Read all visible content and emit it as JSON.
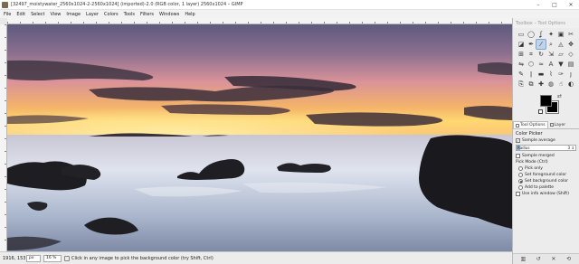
{
  "window": {
    "title": "[32497_moistywater_2560x1024-2-2560x1024] (imported)-2.0 (RGB color, 1 layer) 2560x1024 – GIMP",
    "minimize": "–",
    "maximize": "□",
    "close": "✕"
  },
  "menu": [
    "File",
    "Edit",
    "Select",
    "View",
    "Image",
    "Layer",
    "Colors",
    "Tools",
    "Filters",
    "Windows",
    "Help"
  ],
  "dock": {
    "header": "Toolbox – Tool Options",
    "tools": [
      {
        "icon": "rect-select-icon",
        "glyph": "▭"
      },
      {
        "icon": "ellipse-select-icon",
        "glyph": "◯"
      },
      {
        "icon": "free-select-icon",
        "glyph": "ʆ"
      },
      {
        "icon": "fuzzy-select-icon",
        "glyph": "✦"
      },
      {
        "icon": "color-select-icon",
        "glyph": "▣"
      },
      {
        "icon": "scissors-icon",
        "glyph": "✂"
      },
      {
        "icon": "foreground-select-icon",
        "glyph": "◪"
      },
      {
        "icon": "paths-icon",
        "glyph": "✒"
      },
      {
        "icon": "color-picker-icon",
        "glyph": "⁄"
      },
      {
        "icon": "zoom-icon",
        "glyph": "⌕"
      },
      {
        "icon": "measure-icon",
        "glyph": "◬"
      },
      {
        "icon": "move-icon",
        "glyph": "✥"
      },
      {
        "icon": "align-icon",
        "glyph": "⊞"
      },
      {
        "icon": "crop-icon",
        "glyph": "⌗"
      },
      {
        "icon": "rotate-icon",
        "glyph": "↻"
      },
      {
        "icon": "scale-icon",
        "glyph": "⇲"
      },
      {
        "icon": "shear-icon",
        "glyph": "▱"
      },
      {
        "icon": "perspective-icon",
        "glyph": "◇"
      },
      {
        "icon": "flip-icon",
        "glyph": "⇋"
      },
      {
        "icon": "cage-icon",
        "glyph": "⬡"
      },
      {
        "icon": "warp-icon",
        "glyph": "≈"
      },
      {
        "icon": "text-icon",
        "glyph": "A"
      },
      {
        "icon": "bucket-fill-icon",
        "glyph": "▼"
      },
      {
        "icon": "gradient-icon",
        "glyph": "▤"
      },
      {
        "icon": "pencil-icon",
        "glyph": "✎"
      },
      {
        "icon": "paintbrush-icon",
        "glyph": "ǀ"
      },
      {
        "icon": "eraser-icon",
        "glyph": "▬"
      },
      {
        "icon": "airbrush-icon",
        "glyph": "⌇"
      },
      {
        "icon": "ink-icon",
        "glyph": "✑"
      },
      {
        "icon": "mypaint-brush-icon",
        "glyph": "ȷ"
      },
      {
        "icon": "clone-icon",
        "glyph": "⎘"
      },
      {
        "icon": "perspective-clone-icon",
        "glyph": "⧉"
      },
      {
        "icon": "heal-icon",
        "glyph": "✚"
      },
      {
        "icon": "blur-icon",
        "glyph": "◍"
      },
      {
        "icon": "smudge-icon",
        "glyph": "☝"
      },
      {
        "icon": "dodge-burn-icon",
        "glyph": "◐"
      }
    ],
    "active_tool_index": 8,
    "tabs": [
      {
        "icon": "tool-options-icon",
        "label": "Tool Options"
      },
      {
        "icon": "layers-icon",
        "label": "Layer"
      }
    ],
    "options": {
      "title": "Color Picker",
      "sample_average": "Sample average",
      "radius_label": "Radius",
      "radius_value": "3",
      "radius_fraction": 0.06,
      "sample_merged": "Sample merged",
      "pick_mode_label": "Pick Mode  (Ctrl)",
      "pick_only": "Pick only",
      "set_foreground": "Set foreground color",
      "set_background": "Set background color",
      "add_to_palette": "Add to palette",
      "use_info_window": "Use info window  (Shift)"
    }
  },
  "status": {
    "coords": "1916, 153",
    "unit": "px",
    "zoom": "16 %",
    "message": "Click in any image to pick the background color (try Shift, Ctrl)"
  },
  "colors": {
    "foreground": "#000000",
    "background": "#000000",
    "accent": "#bfd3ea"
  }
}
